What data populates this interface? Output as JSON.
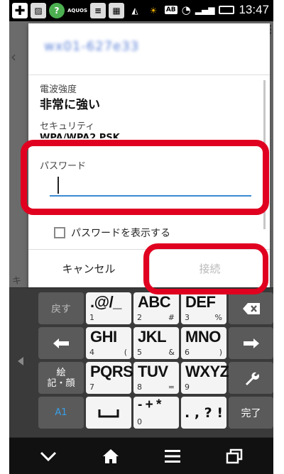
{
  "status_bar": {
    "time": "13:47",
    "network_label": "AB",
    "aquos_label": "AQUOS",
    "icons": [
      "plus-icon",
      "image-icon",
      "help-icon",
      "aquos-icon",
      "notes-icon",
      "qr-icon",
      "warning-icon",
      "weather-icon",
      "wifi-icon",
      "signal-icon",
      "battery-icon"
    ]
  },
  "dialog": {
    "network_name": "wx01-627e33",
    "signal_label": "電波強度",
    "signal_value": "非常に強い",
    "security_label": "セキュリティ",
    "security_value": "WPA/WPA2 PSK",
    "password_label": "パスワード",
    "password_value": "",
    "show_password_label": "パスワードを表示する",
    "cancel_label": "キャンセル",
    "connect_label": "接続"
  },
  "background_app": {
    "partial_label": "キ"
  },
  "keyboard": {
    "rows": [
      [
        {
          "label": "戻す",
          "type": "dark"
        },
        {
          "label": ".@/_",
          "sub_left": "1",
          "sub_right": "",
          "type": "light"
        },
        {
          "label": "ABC",
          "sub_left": "2",
          "sub_right": "#",
          "type": "light"
        },
        {
          "label": "DEF",
          "sub_left": "3",
          "sub_right": "%",
          "type": "light"
        },
        {
          "label": "backspace-icon",
          "type": "dark"
        }
      ],
      [
        {
          "label": "left-arrow-icon",
          "type": "dark"
        },
        {
          "label": "GHI",
          "sub_left": "4",
          "sub_right": "(",
          "type": "light"
        },
        {
          "label": "JKL",
          "sub_left": "5",
          "sub_right": "&",
          "type": "light"
        },
        {
          "label": "MNO",
          "sub_left": "6",
          "sub_right": ")",
          "type": "light"
        },
        {
          "label": "right-arrow-icon",
          "type": "dark"
        }
      ],
      [
        {
          "label": "絵\n記・顔",
          "type": "dark"
        },
        {
          "label": "PQRS",
          "sub_left": "7",
          "sub_right": "",
          "type": "light"
        },
        {
          "label": "TUV",
          "sub_left": "8",
          "sub_right": "=",
          "type": "light"
        },
        {
          "label": "WXYZ",
          "sub_left": "9",
          "sub_right": "",
          "type": "light"
        },
        {
          "label": "wrench-icon",
          "type": "dark"
        }
      ],
      [
        {
          "label": "A1",
          "type": "dark"
        },
        {
          "label": "space-icon",
          "type": "light"
        },
        {
          "label": "- + *",
          "sub_left": "0",
          "sub_right": "",
          "type": "light"
        },
        {
          "label": ". , ? !",
          "sub_left": "",
          "sub_right": "",
          "type": "light"
        },
        {
          "label": "完了",
          "type": "dark"
        }
      ]
    ]
  },
  "nav_bar": {
    "buttons": [
      "chevron-down-icon",
      "home-icon",
      "menu-icon",
      "recent-apps-icon"
    ]
  },
  "highlights": {
    "color": "#e0001f"
  }
}
